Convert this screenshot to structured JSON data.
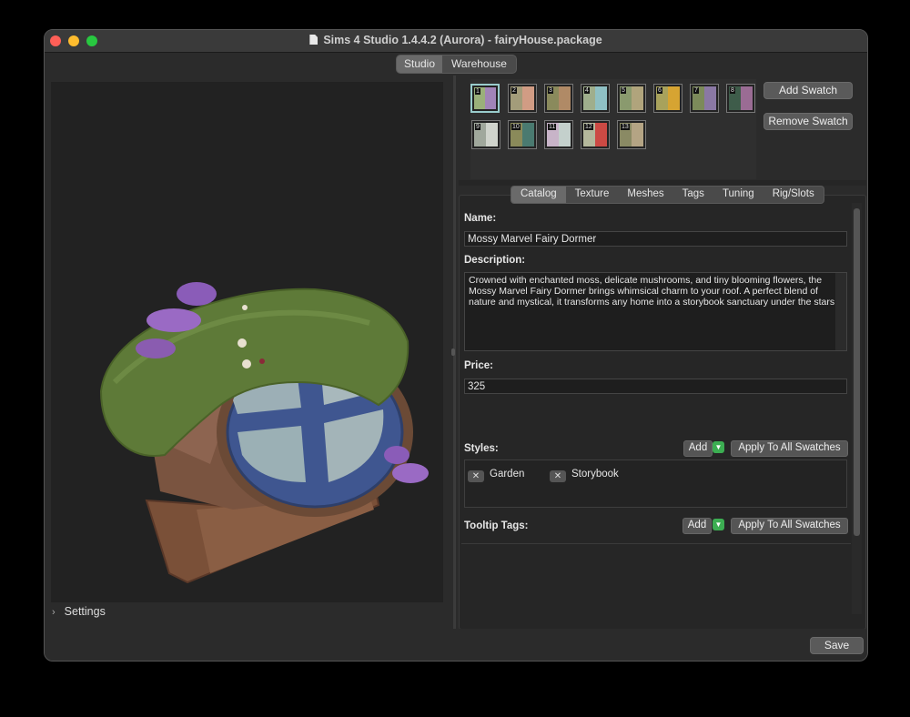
{
  "window": {
    "title": "Sims 4 Studio 1.4.4.2 (Aurora)  - fairyHouse.package"
  },
  "modes": [
    {
      "label": "Studio",
      "active": true
    },
    {
      "label": "Warehouse",
      "active": false
    }
  ],
  "swatches": [
    {
      "num": "1",
      "colors": [
        "#9ab07a",
        "#a184b8"
      ],
      "selected": true
    },
    {
      "num": "2",
      "colors": [
        "#a39c7a",
        "#d19c84"
      ],
      "selected": false
    },
    {
      "num": "3",
      "colors": [
        "#8a8a5c",
        "#b08a66"
      ],
      "selected": false
    },
    {
      "num": "4",
      "colors": [
        "#9fae8c",
        "#8fc0c4"
      ],
      "selected": false
    },
    {
      "num": "5",
      "colors": [
        "#8a9a6e",
        "#b0a47c"
      ],
      "selected": false
    },
    {
      "num": "6",
      "colors": [
        "#a8a25c",
        "#d6a432"
      ],
      "selected": false
    },
    {
      "num": "7",
      "colors": [
        "#7c8a5a",
        "#8a78a4"
      ],
      "selected": false
    },
    {
      "num": "8",
      "colors": [
        "#3e5c4a",
        "#9a6c94"
      ],
      "selected": false
    },
    {
      "num": "9",
      "colors": [
        "#a0a89c",
        "#d0d4cc"
      ],
      "selected": false
    },
    {
      "num": "10",
      "colors": [
        "#8a8a5a",
        "#4a7a70"
      ],
      "selected": false
    },
    {
      "num": "11",
      "colors": [
        "#c8b4c8",
        "#c4d0cc"
      ],
      "selected": false
    },
    {
      "num": "12",
      "colors": [
        "#b4b89c",
        "#cc4a44"
      ],
      "selected": false
    },
    {
      "num": "13",
      "colors": [
        "#8a8a64",
        "#b4a484"
      ],
      "selected": false
    }
  ],
  "swatch_buttons": {
    "add": "Add Swatch",
    "remove": "Remove Swatch"
  },
  "tabs": [
    {
      "label": "Catalog",
      "active": true
    },
    {
      "label": "Texture",
      "active": false
    },
    {
      "label": "Meshes",
      "active": false
    },
    {
      "label": "Tags",
      "active": false
    },
    {
      "label": "Tuning",
      "active": false
    },
    {
      "label": "Rig/Slots",
      "active": false
    }
  ],
  "catalog": {
    "name_label": "Name:",
    "name_value": "Mossy Marvel Fairy Dormer",
    "description_label": "Description:",
    "description_value": "Crowned with enchanted moss, delicate mushrooms, and tiny blooming flowers, the Mossy Marvel Fairy Dormer brings whimsical charm to your roof. A perfect blend of nature and mystical, it transforms any home into a storybook sanctuary under the stars.",
    "price_label": "Price:",
    "price_value": "325",
    "styles_label": "Styles:",
    "add_label": "Add",
    "apply_all_label": "Apply To All Swatches",
    "styles": [
      "Garden",
      "Storybook"
    ],
    "tooltip_label": "Tooltip Tags:"
  },
  "viewport": {
    "settings_label": "Settings"
  },
  "footer": {
    "save_label": "Save"
  }
}
